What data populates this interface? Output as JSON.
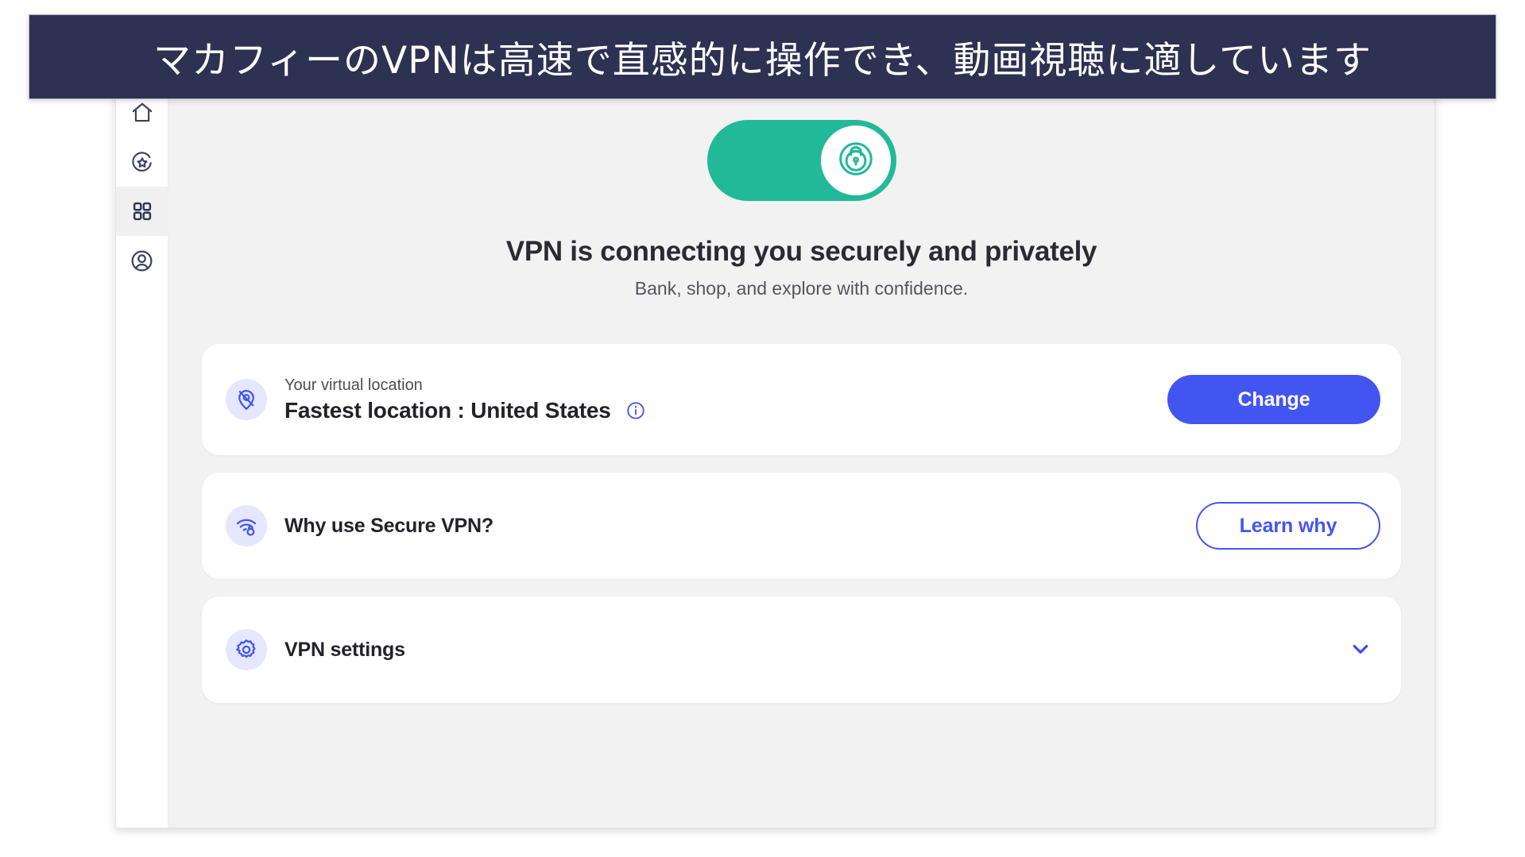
{
  "caption": {
    "text": "マカフィーのVPNは高速で直感的に操作でき、動画視聴に適しています",
    "background_color": "#2d3152",
    "text_color": "#ffffff"
  },
  "sidebar": {
    "items": [
      {
        "name": "home",
        "icon": "home-icon",
        "selected": false
      },
      {
        "name": "protection-score",
        "icon": "star-circle-icon",
        "selected": false
      },
      {
        "name": "apps",
        "icon": "grid-apps-icon",
        "selected": true
      },
      {
        "name": "account",
        "icon": "account-circle-icon",
        "selected": false
      }
    ]
  },
  "hero": {
    "toggle": {
      "state": "on",
      "icon": "lock-shield-icon",
      "track_color": "#22b998",
      "knob_color": "#ffffff"
    },
    "title": "VPN is connecting you securely and privately",
    "subtitle": "Bank, shop, and explore with confidence."
  },
  "cards": {
    "location": {
      "icon": "location-pin-icon",
      "label": "Your virtual location",
      "value": "Fastest location : United States",
      "info_icon": "info-circle-icon",
      "button_label": "Change",
      "button_color": "#4355f0"
    },
    "why": {
      "icon": "wifi-lock-icon",
      "title": "Why use Secure VPN?",
      "button_label": "Learn why",
      "button_border_color": "#4355f0"
    },
    "settings": {
      "icon": "gear-icon",
      "title": "VPN settings",
      "chevron_icon": "chevron-down-icon",
      "expanded": false
    }
  },
  "colors": {
    "accent_blue": "#4355f0",
    "accent_green": "#22b998",
    "icon_bubble": "#e4e7fd",
    "content_bg": "#f2f2f2",
    "card_bg": "#ffffff"
  }
}
